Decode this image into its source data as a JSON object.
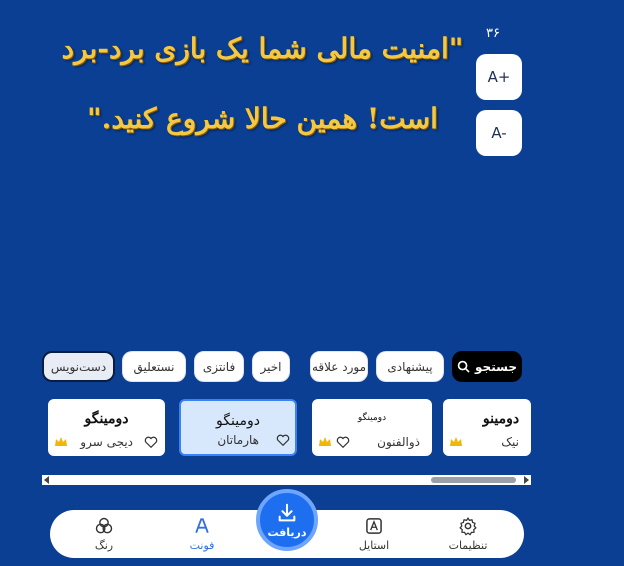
{
  "quote": {
    "line1": "\"امنیت مالی شما یک بازی برد-برد",
    "line2": "است! همین حالا شروع کنید.\""
  },
  "size_controls": {
    "counter": "۳۶",
    "increase": "A+",
    "decrease": "A-"
  },
  "chips": [
    {
      "label": "جستجو",
      "icon": "search-icon"
    },
    {
      "label": "پیشنهادی"
    },
    {
      "label": "مورد علاقه"
    },
    {
      "label": "اخیر"
    },
    {
      "label": "فانتزی"
    },
    {
      "label": "نستعلیق"
    },
    {
      "label": "دست‌نویس",
      "active": true
    }
  ],
  "fonts": [
    {
      "sample": "دومینو",
      "name": "نیک",
      "premium": true
    },
    {
      "sample": "دومینگو",
      "name": "ذوالفنون",
      "premium": true
    },
    {
      "sample": "دومینگو",
      "name": "هارماتان",
      "selected": true
    },
    {
      "sample": "دومینگو",
      "name": "دیجی سرو",
      "premium": true
    }
  ],
  "nav": {
    "settings": "تنظیمات",
    "style": "استایل",
    "receive": "دریافت",
    "font": "فونت",
    "color": "رنگ"
  },
  "colors": {
    "background": "#0a3f94",
    "quote": "#f5c842",
    "accent": "#2f6fe0"
  }
}
